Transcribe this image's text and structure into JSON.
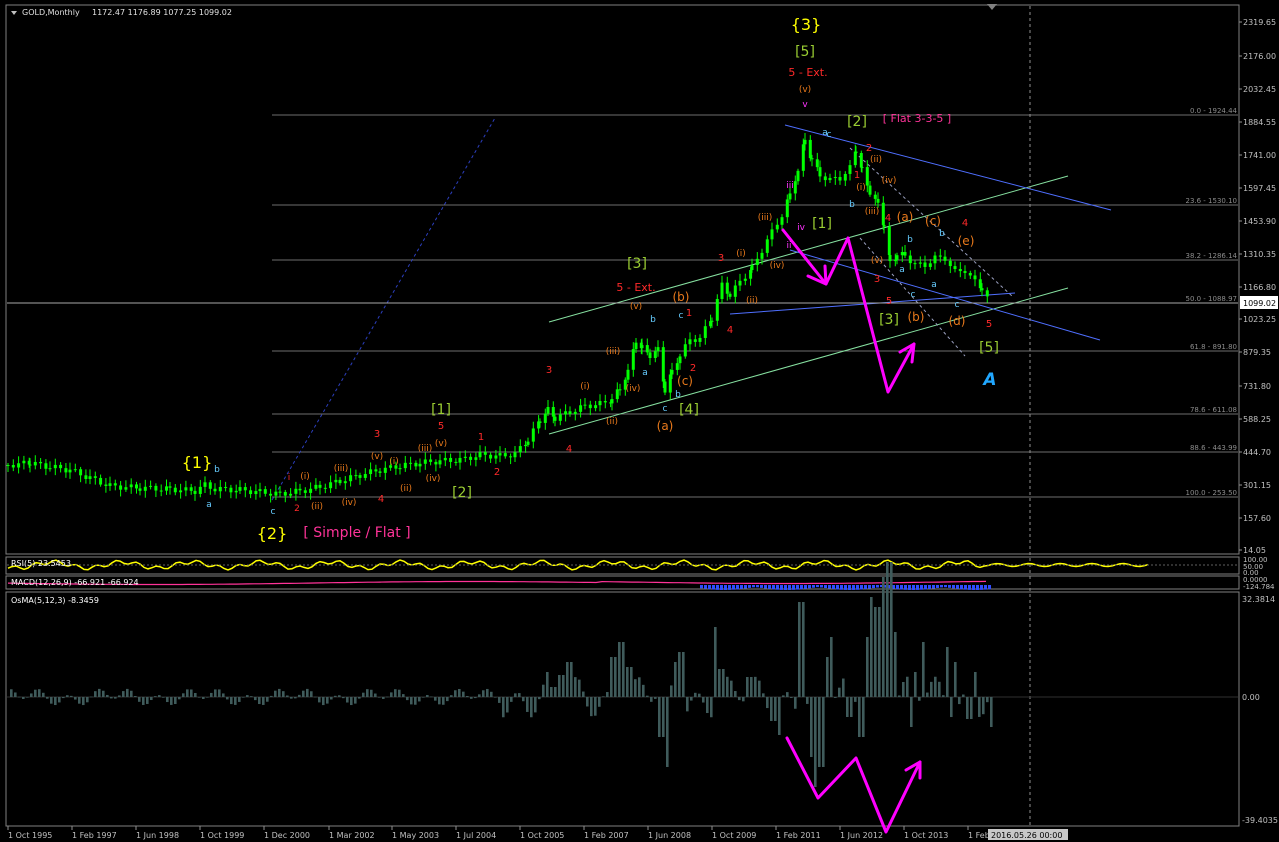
{
  "window": {
    "symbol_caption": "GOLD,Monthly",
    "ohlc": "1172.47 1176.89 1077.25 1099.02",
    "current_price_label": "1099.02"
  },
  "rsi": {
    "caption": "RSI(5) 23.5453",
    "scale_top": "100.00",
    "scale_mid": "50.00",
    "scale_bot": "0.00"
  },
  "macd": {
    "caption": "MACD(12,26,9) -66.921 -66.924",
    "scale_top": "0.0000",
    "scale_bot": "-124.784"
  },
  "osma": {
    "caption": "OsMA(5,12,3) -8.3459",
    "scale_top": "32.3814",
    "scale_mid": "0.00",
    "scale_bot": "-39.4035"
  },
  "price_axis": [
    "2319.65",
    "2176.00",
    "2032.45",
    "1884.55",
    "1741.00",
    "1597.45",
    "1453.90",
    "1310.35",
    "1166.80",
    "1023.25",
    "879.35",
    "731.80",
    "588.25",
    "444.70",
    "301.15",
    "157.60",
    "14.05"
  ],
  "time_axis": [
    "1 Oct 1995",
    "1 Feb 1997",
    "1 Jun 1998",
    "1 Oct 1999",
    "1 Dec 2000",
    "1 Mar 2002",
    "1 May 2003",
    "1 Jul 2004",
    "1 Oct 2005",
    "1 Feb 2007",
    "1 Jun 2008",
    "1 Oct 2009",
    "1 Feb 2011",
    "1 Jun 2012",
    "1 Oct 2013",
    "1 Feb"
  ],
  "time_cursor_label": "2016.05.26 00:00",
  "fib_levels": [
    "0.0 - 1924.44",
    "23.6 - 1530.10",
    "38.2 - 1286.14",
    "50.0 - 1088.97",
    "61.8 - 891.80",
    "78.6 - 611.08",
    "88.6 - 443.99",
    "100.0 - 253.50"
  ],
  "wave_labels": {
    "w3_top": "{3}",
    "w5_box_top": "[5]",
    "ext5_top": "5 - Ext.",
    "v_top": "(v)",
    "v_small": "v",
    "w2_box_right": "[2]",
    "flat335": "[ Flat 3-3-5 ]",
    "w1_curly": "{1}",
    "w2_curly": "{2}",
    "simple_flat": "[ Simple / Flat ]",
    "w1_box_left": "[1]",
    "w2_box_left": "[2]",
    "w3_box_mid": "[3]",
    "ext5_mid": "5 - Ext.",
    "w4_box": "[4]",
    "w1_box_right": "[1]",
    "w3_box_right": "[3]",
    "w5_box_right": "[5]",
    "A_label": "A",
    "a_pre": "a",
    "b_pre": "b",
    "c_pre": "c",
    "i_red": "i",
    "ii_red": "2",
    "one_red": "1",
    "three_red": "3",
    "four_red": "4",
    "five_red": "5",
    "two_red": "2",
    "rn_i": "(i)",
    "rn_ii": "(ii)",
    "rn_iii": "(iii)",
    "rn_iv": "(iv)",
    "rn_v": "(v)",
    "rn_a": "(a)",
    "rn_b": "(b)",
    "rn_c": "(c)",
    "rn_d": "(d)",
    "rn_e": "(e)",
    "iii_m": "iii",
    "iv_m": "iv",
    "ii_m": "ii",
    "c_cyan": "c",
    "b_cyan": "b",
    "a_cyan": "a"
  },
  "colors": {
    "background": "#000000",
    "candle": "#00ff00",
    "axis_text": "#c0c0c0",
    "wave_yellow": "#ffff00",
    "wave_green": "#9acd32",
    "wave_red": "#ff2a2a",
    "wave_orange": "#e8791b",
    "wave_cyan": "#66ccff",
    "wave_magenta": "#ff33ff",
    "fib_line": "#8a8a8a",
    "channel_blue": "#4f6fff",
    "channel_green": "#86e0a0",
    "rsi_line": "#ffff00",
    "macd_line": "#ff3399",
    "osma_bar": "#3f5b5b",
    "arrow_magenta": "#ff00ff"
  }
}
